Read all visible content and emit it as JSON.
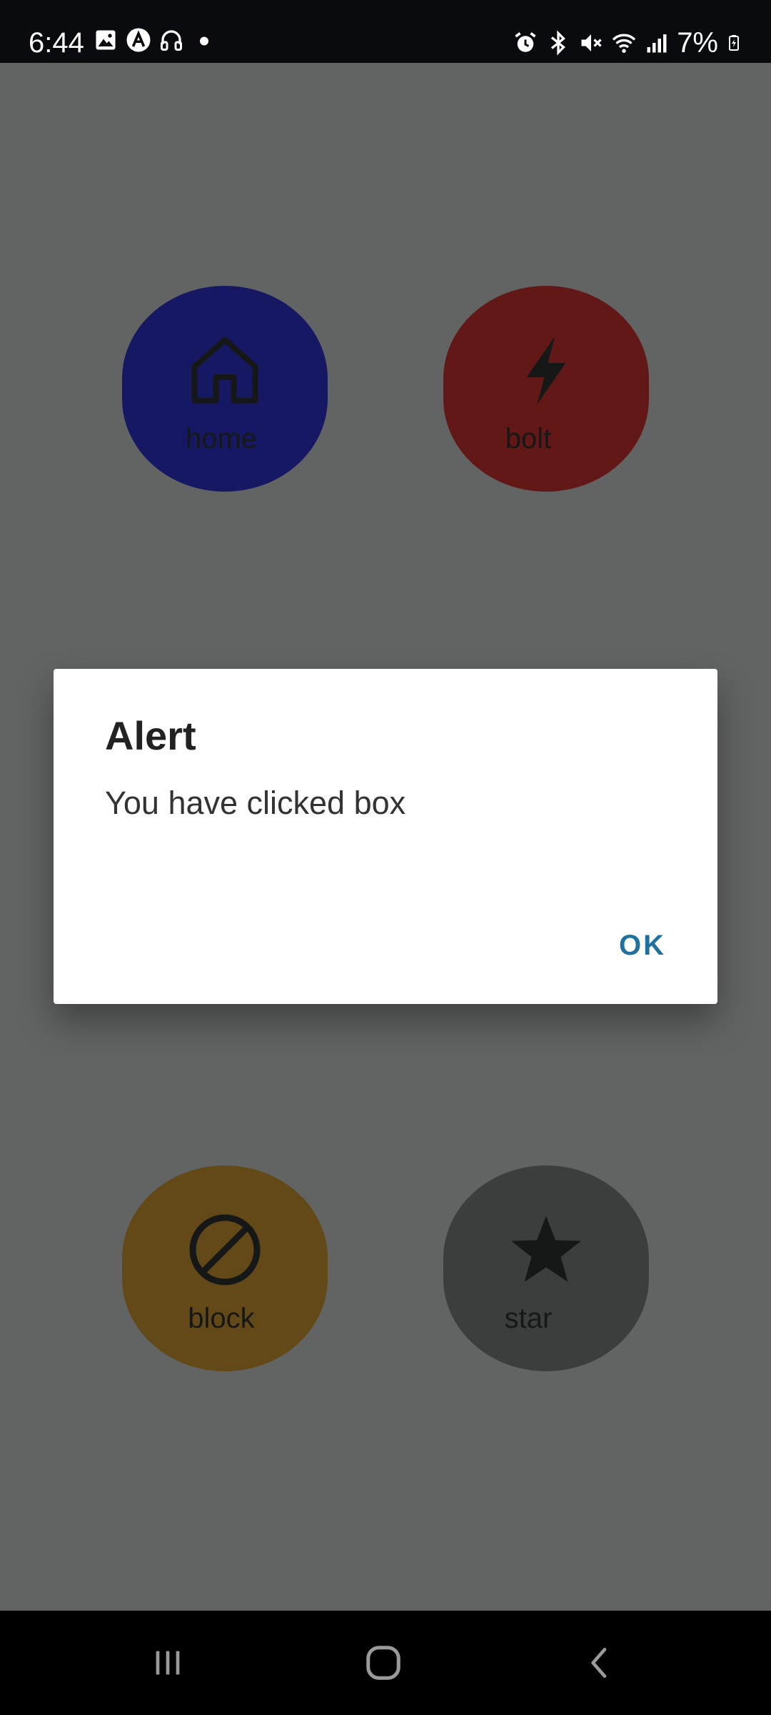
{
  "status_bar": {
    "time": "6:44",
    "battery_percent": "7%",
    "left_icons": [
      "image-icon",
      "app-a-icon",
      "headphones-icon",
      "dot-icon"
    ],
    "right_icons": [
      "alarm-icon",
      "bluetooth-icon",
      "mute-icon",
      "wifi-icon",
      "signal-icon",
      "battery-icon"
    ]
  },
  "tiles": [
    {
      "label": "home",
      "icon": "home-icon",
      "color": "#0000ff"
    },
    {
      "label": "bolt",
      "icon": "bolt-icon",
      "color": "#ff0000"
    },
    {
      "label": "block",
      "icon": "block-icon",
      "color": "#ffa500"
    },
    {
      "label": "star",
      "icon": "star-icon",
      "color": "#808080"
    }
  ],
  "dialog": {
    "title": "Alert",
    "message": "You have clicked box",
    "ok_label": "OK",
    "ok_color": "#20719e"
  },
  "nav_bar": {
    "buttons": [
      "recent-apps-icon",
      "home-nav-icon",
      "back-icon"
    ]
  }
}
